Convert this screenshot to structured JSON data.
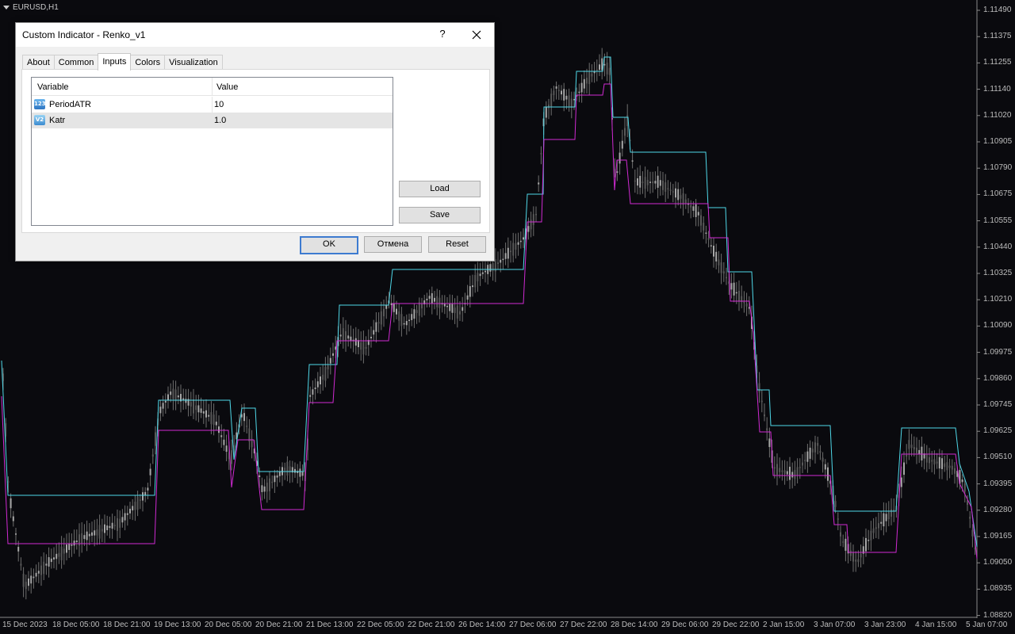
{
  "chart": {
    "title": "EURUSD,H1",
    "price_labels": [
      "1.11490",
      "1.11375",
      "1.11255",
      "1.11140",
      "1.11020",
      "1.10905",
      "1.10790",
      "1.10675",
      "1.10555",
      "1.10440",
      "1.10325",
      "1.10210",
      "1.10090",
      "1.09975",
      "1.09860",
      "1.09745",
      "1.09625",
      "1.09510",
      "1.09395",
      "1.09280",
      "1.09165",
      "1.09050",
      "1.08935",
      "1.08820"
    ],
    "time_labels": [
      "15 Dec 2023",
      "18 Dec 05:00",
      "18 Dec 21:00",
      "19 Dec 13:00",
      "20 Dec 05:00",
      "20 Dec 21:00",
      "21 Dec 13:00",
      "22 Dec 05:00",
      "22 Dec 21:00",
      "26 Dec 14:00",
      "27 Dec 06:00",
      "27 Dec 22:00",
      "28 Dec 14:00",
      "29 Dec 06:00",
      "29 Dec 22:00",
      "2 Jan 15:00",
      "3 Jan 07:00",
      "3 Jan 23:00",
      "4 Jan 15:00",
      "5 Jan 07:00"
    ],
    "colors": {
      "background": "#0a0a0e",
      "upper_line": "#4fd8e8",
      "lower_line": "#d02ad2",
      "candle": "#8a8a8a"
    }
  },
  "dialog": {
    "title": "Custom Indicator - Renko_v1",
    "help": "?",
    "tabs": [
      "About",
      "Common",
      "Inputs",
      "Colors",
      "Visualization"
    ],
    "active_tab": "Inputs",
    "columns": {
      "variable": "Variable",
      "value": "Value"
    },
    "rows": [
      {
        "icon": "123",
        "name": "PeriodATR",
        "value": "10"
      },
      {
        "icon": "V2",
        "name": "Katr",
        "value": "1.0"
      }
    ],
    "buttons": {
      "load": "Load",
      "save": "Save",
      "ok": "OK",
      "cancel": "Отмена",
      "reset": "Reset"
    }
  }
}
